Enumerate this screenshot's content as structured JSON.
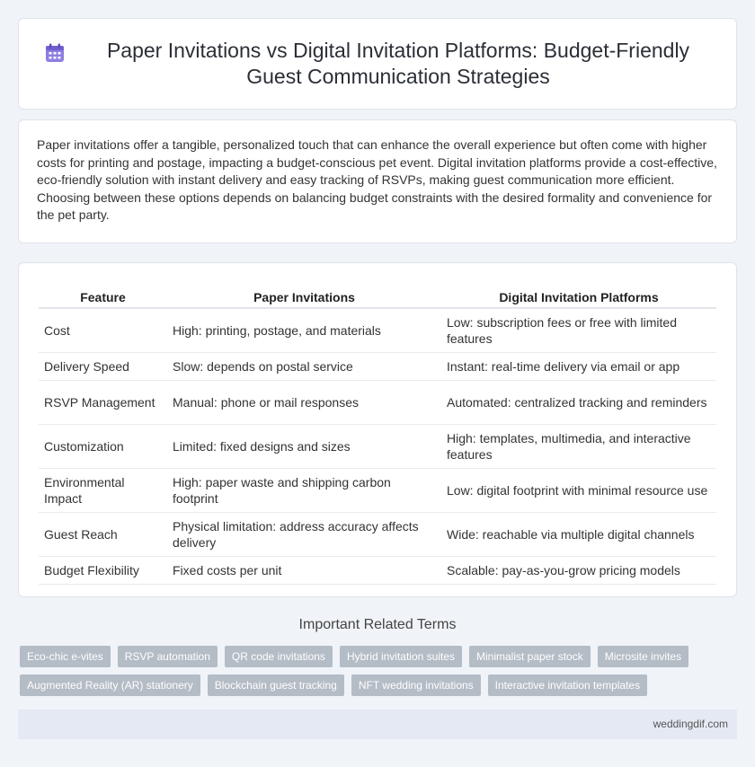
{
  "header": {
    "title": "Paper Invitations vs Digital Invitation Platforms: Budget-Friendly Guest Communication Strategies",
    "icon": "calendar-icon",
    "icon_color": "#7b68d8"
  },
  "intro": {
    "text": "Paper invitations offer a tangible, personalized touch that can enhance the overall experience but often come with higher costs for printing and postage, impacting a budget-conscious pet event. Digital invitation platforms provide a cost-effective, eco-friendly solution with instant delivery and easy tracking of RSVPs, making guest communication more efficient. Choosing between these options depends on balancing budget constraints with the desired formality and convenience for the pet party."
  },
  "table": {
    "headers": [
      "Feature",
      "Paper Invitations",
      "Digital Invitation Platforms"
    ],
    "rows": [
      [
        "Cost",
        "High: printing, postage, and materials",
        "Low: subscription fees or free with limited features"
      ],
      [
        "Delivery Speed",
        "Slow: depends on postal service",
        "Instant: real-time delivery via email or app"
      ],
      [
        "RSVP Management",
        "Manual: phone or mail responses",
        "Automated: centralized tracking and reminders"
      ],
      [
        "Customization",
        "Limited: fixed designs and sizes",
        "High: templates, multimedia, and interactive features"
      ],
      [
        "Environmental Impact",
        "High: paper waste and shipping carbon footprint",
        "Low: digital footprint with minimal resource use"
      ],
      [
        "Guest Reach",
        "Physical limitation: address accuracy affects delivery",
        "Wide: reachable via multiple digital channels"
      ],
      [
        "Budget Flexibility",
        "Fixed costs per unit",
        "Scalable: pay-as-you-grow pricing models"
      ]
    ]
  },
  "related": {
    "heading": "Important Related Terms",
    "tags": [
      "Eco-chic e-vites",
      "RSVP automation",
      "QR code invitations",
      "Hybrid invitation suites",
      "Minimalist paper stock",
      "Microsite invites",
      "Augmented Reality (AR) stationery",
      "Blockchain guest tracking",
      "NFT wedding invitations",
      "Interactive invitation templates"
    ],
    "tag_color": "#b4bcc6"
  },
  "footer": {
    "site": "weddingdif.com"
  }
}
